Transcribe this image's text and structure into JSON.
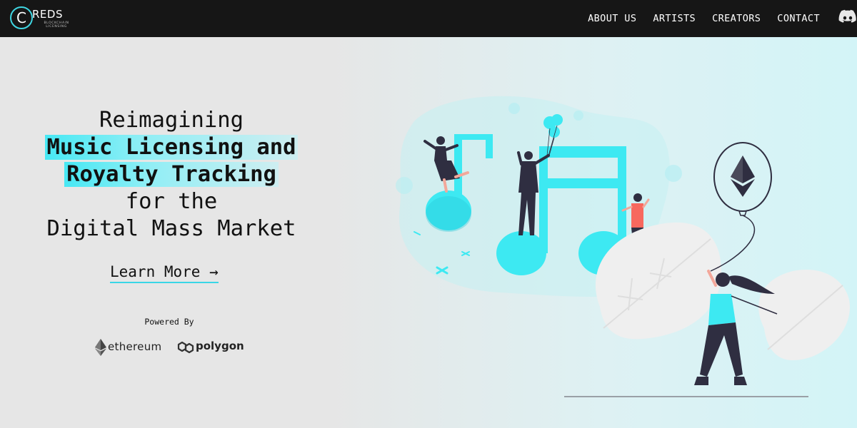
{
  "brand": {
    "logo_letter": "C",
    "logo_word": "REDS",
    "logo_tagline": "BLOCKCHAIN LICENSING"
  },
  "nav": {
    "links": [
      "ABOUT US",
      "ARTISTS",
      "CREATORS",
      "CONTACT"
    ],
    "discord_icon": "discord-icon"
  },
  "hero": {
    "line1": "Reimagining",
    "line2": "Music Licensing and",
    "line3": "Royalty Tracking",
    "line4": "for the",
    "line5": "Digital Mass Market",
    "cta": "Learn More →"
  },
  "powered": {
    "label": "Powered By",
    "partners": [
      {
        "name": "ethereum",
        "icon": "ethereum-icon"
      },
      {
        "name": "polygon",
        "icon": "polygon-icon"
      }
    ]
  },
  "colors": {
    "accent": "#3de9f2",
    "nav_bg": "#161616",
    "text": "#111111"
  }
}
